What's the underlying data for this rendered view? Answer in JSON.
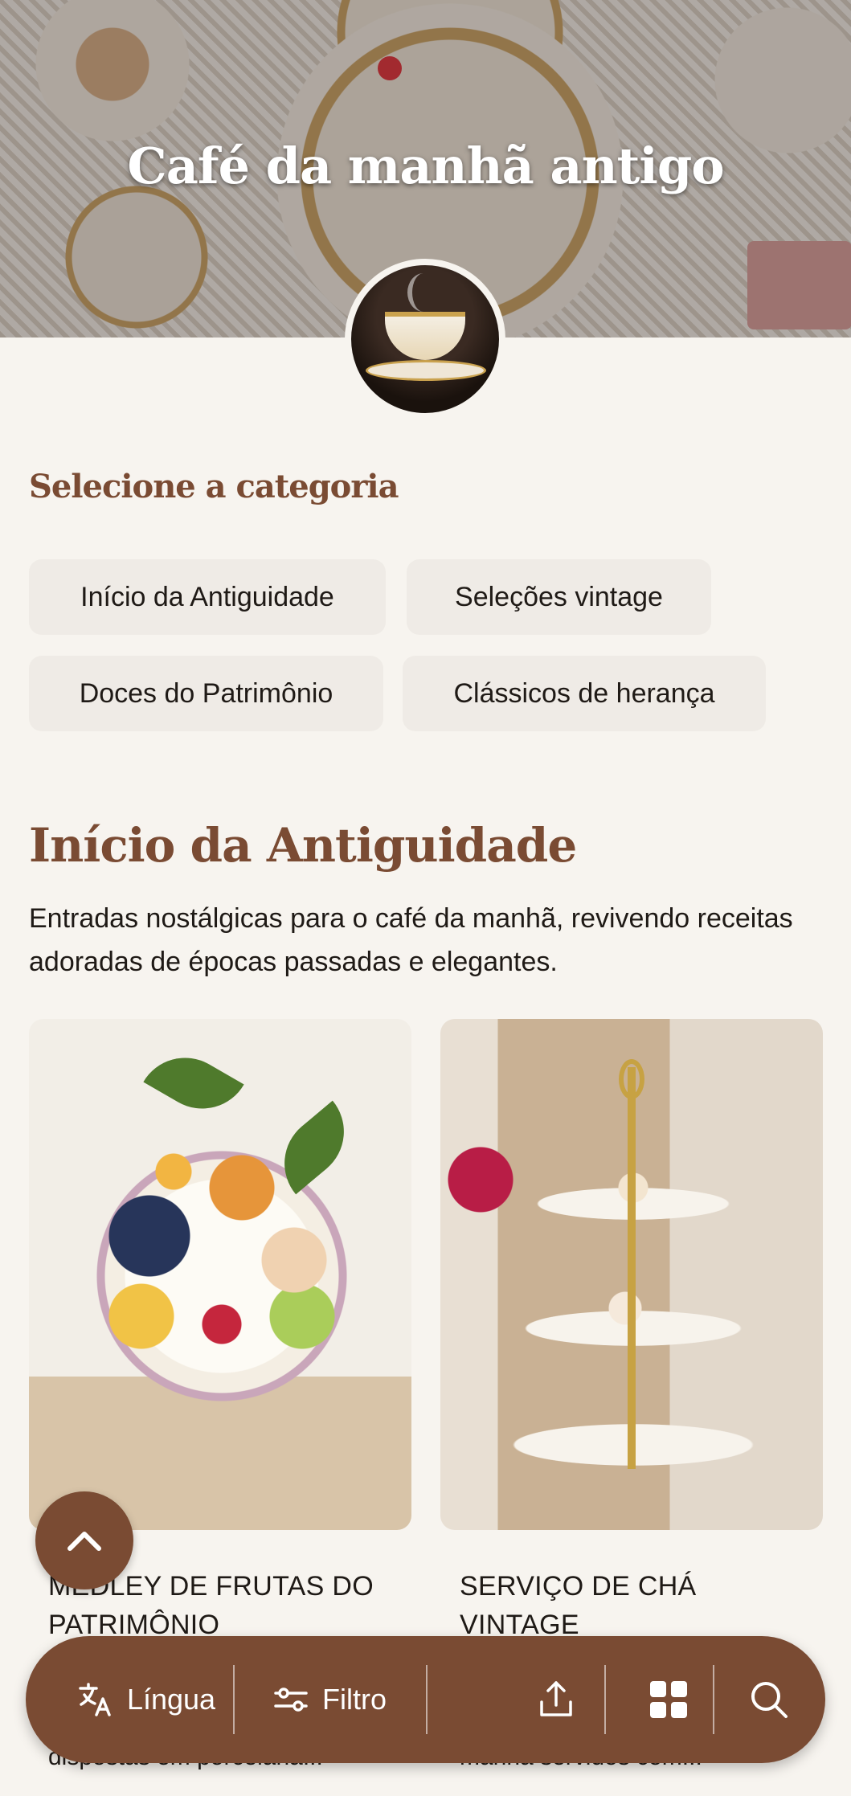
{
  "hero": {
    "title": "Café da manhã antigo"
  },
  "category": {
    "heading": "Selecione a categoria",
    "chips": [
      "Início da Antiguidade",
      "Seleções vintage",
      "Doces do Patrimônio",
      "Clássicos de herança"
    ]
  },
  "section": {
    "title": "Início da Antiguidade",
    "description": "Entradas nostálgicas para o café da manhã, revivendo receitas adoradas de épocas passadas e elegantes."
  },
  "cards": [
    {
      "title": "MEDLEY DE FRUTAS DO PATRIMÔNIO",
      "snippet": "dispostas em porcelana..."
    },
    {
      "title": "SERVIÇO DE CHÁ VINTAGE",
      "snippet": "manhã servidos com..."
    }
  ],
  "bottom_bar": {
    "language_label": "Língua",
    "filter_label": "Filtro",
    "icons": [
      "translate-icon",
      "filter-icon",
      "share-icon",
      "grid-icon",
      "search-icon"
    ]
  },
  "colors": {
    "accent": "#7a4b33",
    "background": "#f7f4ef",
    "chip": "#efebe6"
  }
}
